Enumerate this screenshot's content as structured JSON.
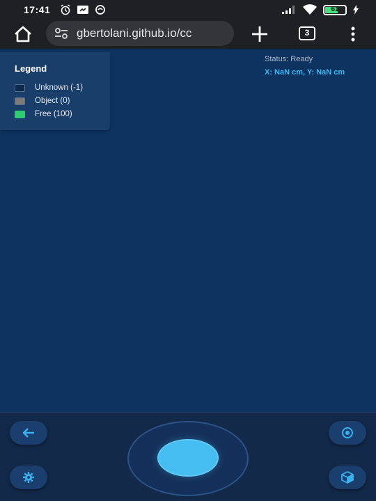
{
  "status_bar": {
    "time": "17:41",
    "battery_level": "61",
    "left_icons": [
      "alarm-clock-icon",
      "screen-mirror-icon",
      "data-saver-icon"
    ],
    "right_icons": [
      "signal-icon",
      "wifi-icon",
      "battery-icon",
      "charging-bolt-icon"
    ]
  },
  "browser": {
    "url": "gbertolani.github.io/cc",
    "tab_count": "3",
    "icons": [
      "home-icon",
      "site-settings-icon",
      "new-tab-plus-icon",
      "tabs-icon",
      "menu-kebab-icon"
    ]
  },
  "map": {
    "background_color": "#0d3461",
    "legend": {
      "title": "Legend",
      "items": [
        {
          "label": "Unknown (-1)",
          "color": "#0d2a4d"
        },
        {
          "label": "Object (0)",
          "color": "#7b7b7b"
        },
        {
          "label": "Free (100)",
          "color": "#2ecc71"
        }
      ]
    },
    "status": "Status: Ready",
    "coordinates": "X: NaN cm, Y: NaN cm"
  },
  "controls": {
    "buttons": [
      {
        "name": "back",
        "icon": "arrow-left-icon"
      },
      {
        "name": "view",
        "icon": "eye-icon"
      },
      {
        "name": "settings",
        "icon": "gear-icon"
      },
      {
        "name": "3d-view",
        "icon": "cube-icon"
      }
    ],
    "accent_color": "#45bdf0"
  }
}
